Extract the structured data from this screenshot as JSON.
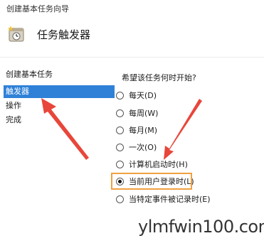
{
  "window": {
    "title": "创建基本任务向导"
  },
  "header": {
    "title": "任务触发器",
    "icon": "task-scheduler-icon"
  },
  "sidebar": {
    "items": [
      {
        "label": "创建基本任务",
        "selected": false
      },
      {
        "label": "触发器",
        "selected": true
      },
      {
        "label": "操作",
        "selected": false
      },
      {
        "label": "完成",
        "selected": false
      }
    ]
  },
  "main": {
    "question": "希望该任务何时开始?",
    "options": [
      {
        "label": "每天(D)",
        "checked": false
      },
      {
        "label": "每周(W)",
        "checked": false
      },
      {
        "label": "每月(M)",
        "checked": false
      },
      {
        "label": "一次(O)",
        "checked": false
      },
      {
        "label": "计算机启动时(H)",
        "checked": false
      },
      {
        "label": "当前用户登录时(L)",
        "checked": true
      },
      {
        "label": "当特定事件被记录时(E)",
        "checked": false
      }
    ]
  },
  "annotations": {
    "arrow_color": "#e8463a",
    "highlight_color": "#f0a040"
  },
  "watermark": {
    "text": "ylmfwin100.com"
  }
}
